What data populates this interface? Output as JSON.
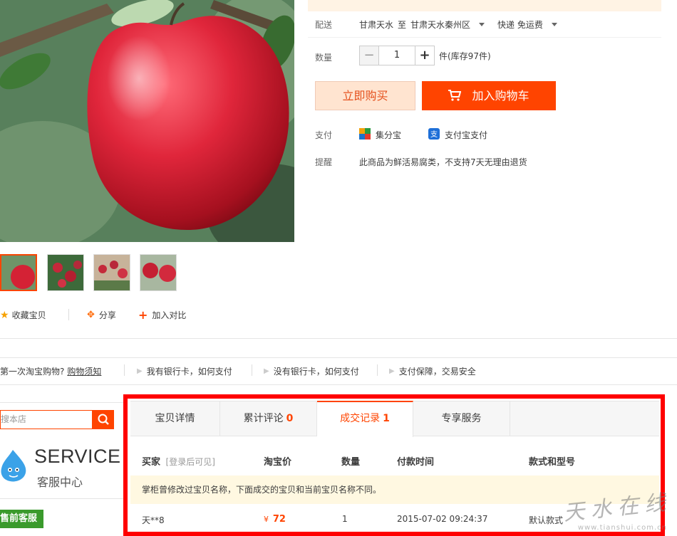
{
  "delivery": {
    "label": "配送",
    "from": "甘肃天水",
    "to_word": "至",
    "to": "甘肃天水秦州区",
    "shipping": "快递 免运费"
  },
  "quantity": {
    "label": "数量",
    "minus": "−",
    "value": "1",
    "plus": "+",
    "stock_text": "件(库存97件)"
  },
  "actions": {
    "buy_now": "立即购买",
    "add_cart": "加入购物车"
  },
  "payment": {
    "label": "支付",
    "method1": "集分宝",
    "method2": "支付宝支付"
  },
  "reminder": {
    "label": "提醒",
    "text": "此商品为鲜活易腐类，不支持7天无理由退货"
  },
  "product_links": {
    "favorite": "收藏宝贝",
    "share": "分享",
    "compare": "加入对比"
  },
  "help_bar": {
    "first_time": "第一次淘宝购物?",
    "guide": "购物须知",
    "bank_card": "我有银行卡，如何支付",
    "no_bank_card": "没有银行卡，如何支付",
    "guarantee": "支付保障，交易安全"
  },
  "sidebar": {
    "search_placeholder": "搜本店",
    "service_en": "SERVICE",
    "service_cn": "客服中心",
    "presale_badge": "售前客服"
  },
  "tabs": [
    {
      "label": "宝贝详情",
      "count": ""
    },
    {
      "label": "累计评论",
      "count": "0"
    },
    {
      "label": "成交记录",
      "count": "1"
    },
    {
      "label": "专享服务",
      "count": ""
    }
  ],
  "records": {
    "headers": {
      "buyer": "买家",
      "buyer_note": "[登录后可见]",
      "price": "淘宝价",
      "qty": "数量",
      "time": "付款时间",
      "style": "款式和型号"
    },
    "notice": "掌柜曾修改过宝贝名称，下面成交的宝贝和当前宝贝名称不同。",
    "rows": [
      {
        "buyer": "天**8",
        "price_symbol": "¥",
        "price": "72",
        "qty": "1",
        "time": "2015-07-02 09:24:37",
        "style": "默认款式"
      }
    ]
  },
  "watermark": {
    "text": "天水在线",
    "url": "www.tianshui.com.cn"
  },
  "colors": {
    "accent": "#ff4400",
    "highlight_frame": "#ff0000",
    "buy_now_bg": "#ffe4d0",
    "notice_bg": "#fff8e1"
  }
}
